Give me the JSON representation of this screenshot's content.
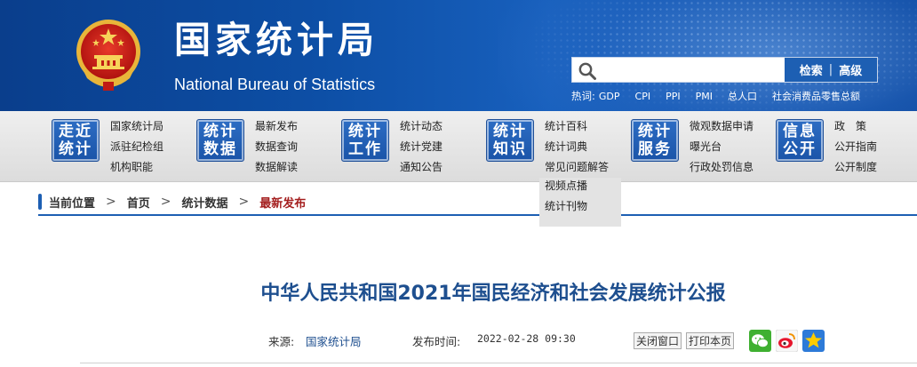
{
  "header": {
    "title_cn": "国家统计局",
    "title_en": "National Bureau of Statistics"
  },
  "search": {
    "placeholder": "",
    "search_label": "检索",
    "separator": "|",
    "advanced_label": "高级"
  },
  "hot": {
    "label": "热词:",
    "items": [
      "GDP",
      "CPI",
      "PPI",
      "PMI",
      "总人口",
      "社会消费品零售总额"
    ]
  },
  "nav": [
    {
      "badge": [
        "走近",
        "统计"
      ],
      "links": [
        "国家统计局",
        "派驻纪检组",
        "机构职能"
      ]
    },
    {
      "badge": [
        "统计",
        "数据"
      ],
      "links": [
        "最新发布",
        "数据查询",
        "数据解读"
      ]
    },
    {
      "badge": [
        "统计",
        "工作"
      ],
      "links": [
        "统计动态",
        "统计党建",
        "通知公告"
      ]
    },
    {
      "badge": [
        "统计",
        "知识"
      ],
      "links": [
        "统计百科",
        "统计词典",
        "常见问题解答"
      ],
      "dropdown": [
        "视频点播",
        "统计刊物"
      ]
    },
    {
      "badge": [
        "统计",
        "服务"
      ],
      "links": [
        "微观数据申请",
        "曝光台",
        "行政处罚信息"
      ]
    },
    {
      "badge": [
        "信息",
        "公开"
      ],
      "links": [
        "政　策",
        "公开指南",
        "公开制度"
      ]
    }
  ],
  "breadcrumb": {
    "label": "当前位置",
    "home": "首页",
    "section": "统计数据",
    "current": "最新发布"
  },
  "article": {
    "title": "中华人民共和国2021年国民经济和社会发展统计公报",
    "source_label": "来源:",
    "source": "国家统计局",
    "date_label": "发布时间:",
    "date": "2022-02-28  09:30",
    "close_label": "关闭窗口",
    "print_label": "打印本页"
  },
  "colors": {
    "header_blue": "#0d4fa6",
    "nav_badge": "#1a54a8",
    "title_blue": "#1e4f8f",
    "breadcrumb_current": "#a41e1e"
  }
}
